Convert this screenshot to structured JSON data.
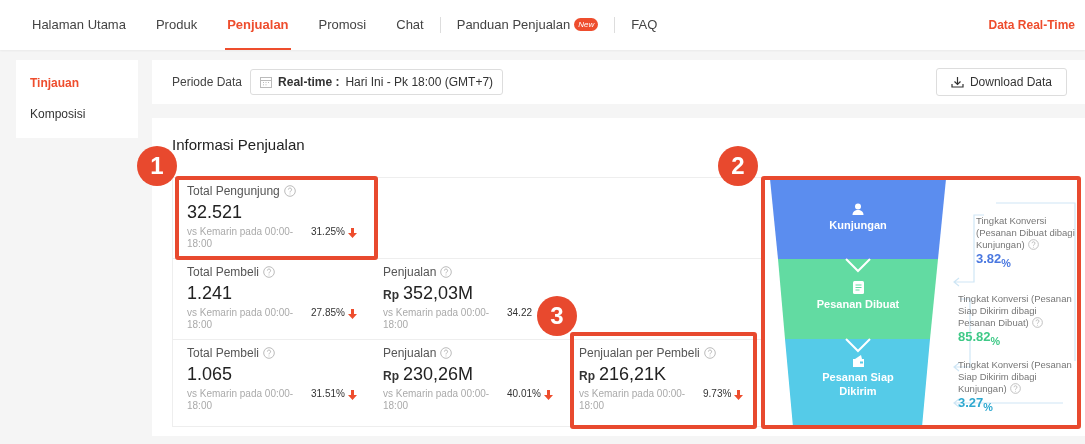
{
  "nav": {
    "items": [
      {
        "label": "Halaman Utama",
        "selected": false,
        "separated": false
      },
      {
        "label": "Produk",
        "selected": false,
        "separated": false
      },
      {
        "label": "Penjualan",
        "selected": true,
        "separated": false
      },
      {
        "label": "Promosi",
        "selected": false,
        "separated": false
      },
      {
        "label": "Chat",
        "selected": false,
        "separated": false
      },
      {
        "label": "Panduan Penjualan",
        "selected": false,
        "separated": true,
        "badge": "New"
      },
      {
        "label": "FAQ",
        "selected": false,
        "separated": true
      }
    ],
    "right_link": "Data Real-Time"
  },
  "sidebar": {
    "items": [
      {
        "label": "Tinjauan",
        "selected": true
      },
      {
        "label": "Komposisi",
        "selected": false
      }
    ]
  },
  "period": {
    "label": "Periode Data",
    "mode": "Real-time :",
    "value": "Hari Ini - Pk 18:00 (GMT+7)",
    "download_button": "Download Data"
  },
  "section_title": "Informasi Penjualan",
  "metric_rows": [
    [
      {
        "title": "Total Pengunjung",
        "value": "32.521",
        "compare": "vs Kemarin pada 00:00-18:00",
        "change": "31.25%",
        "decrease": true
      }
    ],
    [
      {
        "title": "Total Pembeli",
        "value": "1.241",
        "compare": "vs Kemarin pada 00:00-18:00",
        "change": "27.85%",
        "decrease": true
      },
      {
        "title": "Penjualan",
        "currency": "Rp",
        "value": "352,03M",
        "compare": "vs Kemarin pada 00:00-18:00",
        "change": "34.22"
      }
    ],
    [
      {
        "title": "Total Pembeli",
        "value": "1.065",
        "compare": "vs Kemarin pada 00:00-18:00",
        "change": "31.51%",
        "decrease": true
      },
      {
        "title": "Penjualan",
        "currency": "Rp",
        "value": "230,26M",
        "compare": "vs Kemarin pada 00:00-18:00",
        "change": "40.01%",
        "decrease": true
      },
      {
        "title": "Penjualan per Pembeli",
        "currency": "Rp",
        "value": "216,21K",
        "compare": "vs Kemarin pada 00:00-18:00",
        "change": "9.73%",
        "decrease": true
      }
    ]
  ],
  "funnel": {
    "stages": [
      {
        "label": "Kunjungan",
        "kind": "person",
        "color": "#5b8def"
      },
      {
        "label": "Pesanan Dibuat",
        "kind": "document",
        "color": "#62dba2"
      },
      {
        "label": "Pesanan Siap Dikirim",
        "kind": "wallet",
        "color": "#55cbe8"
      }
    ],
    "conversions": [
      {
        "label": "Tingkat Konversi (Pesanan Dibuat dibagi Kunjungan)",
        "value": "3.82$_{%}$",
        "color": "#4a78e0"
      },
      {
        "label": "Tingkat Konversi (Pesanan Siap Dikirim dibagi Pesanan Dibuat)",
        "value": "85.82$_{%}$",
        "color": "#3fc987"
      },
      {
        "label": "Tingkat Konversi (Pesanan Siap Dikirim dibagi Kunjungan)",
        "value": "3.27$_{%}$",
        "color": "#2fa9d0"
      }
    ]
  },
  "callouts": [
    {
      "number": "1"
    },
    {
      "number": "2"
    },
    {
      "number": "3"
    }
  ]
}
